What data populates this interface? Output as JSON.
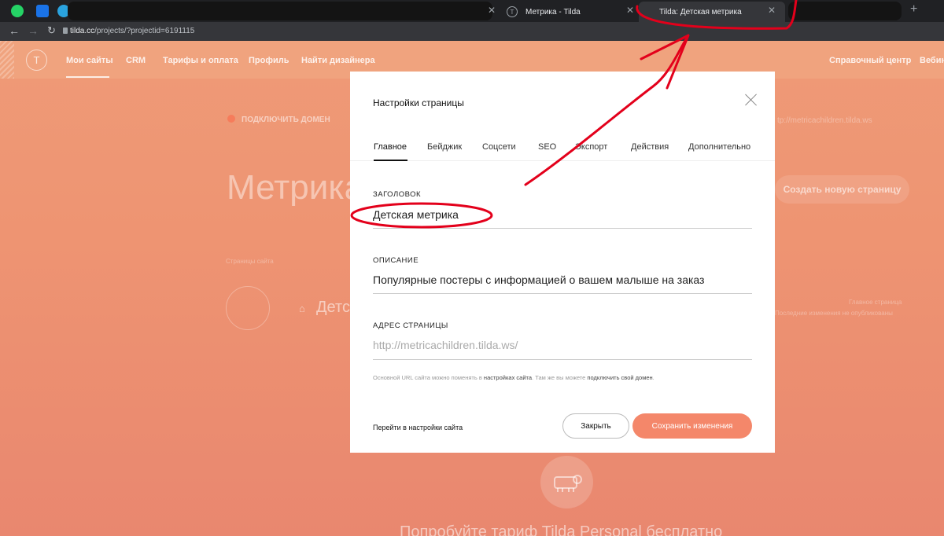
{
  "browser": {
    "tabs": [
      {
        "label": "Метрика - Tilda",
        "icon": "tilda-icon"
      },
      {
        "label": "Tilda: Детская метрика",
        "icon": "tilda-icon"
      }
    ],
    "new_tab_symbol": "+",
    "url_host": "tilda.cc",
    "url_path": "/projects/?projectid=6191115"
  },
  "topnav": {
    "logo": "T",
    "items": [
      "Мои сайты",
      "CRM",
      "Тарифы и оплата",
      "Профиль",
      "Найти дизайнера"
    ],
    "right_items": [
      "Справочный центр",
      "Вебин"
    ]
  },
  "background": {
    "connect_domain": "ПОДКЛЮЧИТЬ ДОМЕН",
    "site_url": "tp://metricachildren.tilda.ws",
    "project_title": "Метрика",
    "create_page_btn": "Создать новую страницу",
    "pages_label": "Страницы сайта",
    "page_name": "Детс",
    "home_label": "Главное страница",
    "unpublished": "Последние изменения не опубликованы",
    "promo": "Попробуйте тариф Tilda Personal бесплатно"
  },
  "modal": {
    "title": "Настройки страницы",
    "tabs": [
      "Главное",
      "Бейджик",
      "Соцсети",
      "SEO",
      "Экспорт",
      "Действия",
      "Дополнительно"
    ],
    "active_tab": "Главное",
    "fields": {
      "heading_label": "ЗАГОЛОВОК",
      "heading_value": "Детская метрика",
      "description_label": "ОПИСАНИЕ",
      "description_value": "Популярные постеры с информацией о вашем малыше на заказ",
      "address_label": "АДРЕС СТРАНИЦЫ",
      "address_placeholder": "http://metricachildren.tilda.ws/"
    },
    "hint": {
      "part1": "Основной URL сайта можно поменять в ",
      "link1": "настройках сайта",
      "part2": ". Там же вы можете ",
      "link2": "подключить свой домен",
      "part3": "."
    },
    "footer": {
      "settings_link": "Перейти в настройки сайта",
      "close_button": "Закрыть",
      "save_button": "Сохранить изменения"
    }
  },
  "colors": {
    "accent": "#f4876a",
    "annotation": "#e3001b",
    "page_overlay": "#ee9472"
  }
}
